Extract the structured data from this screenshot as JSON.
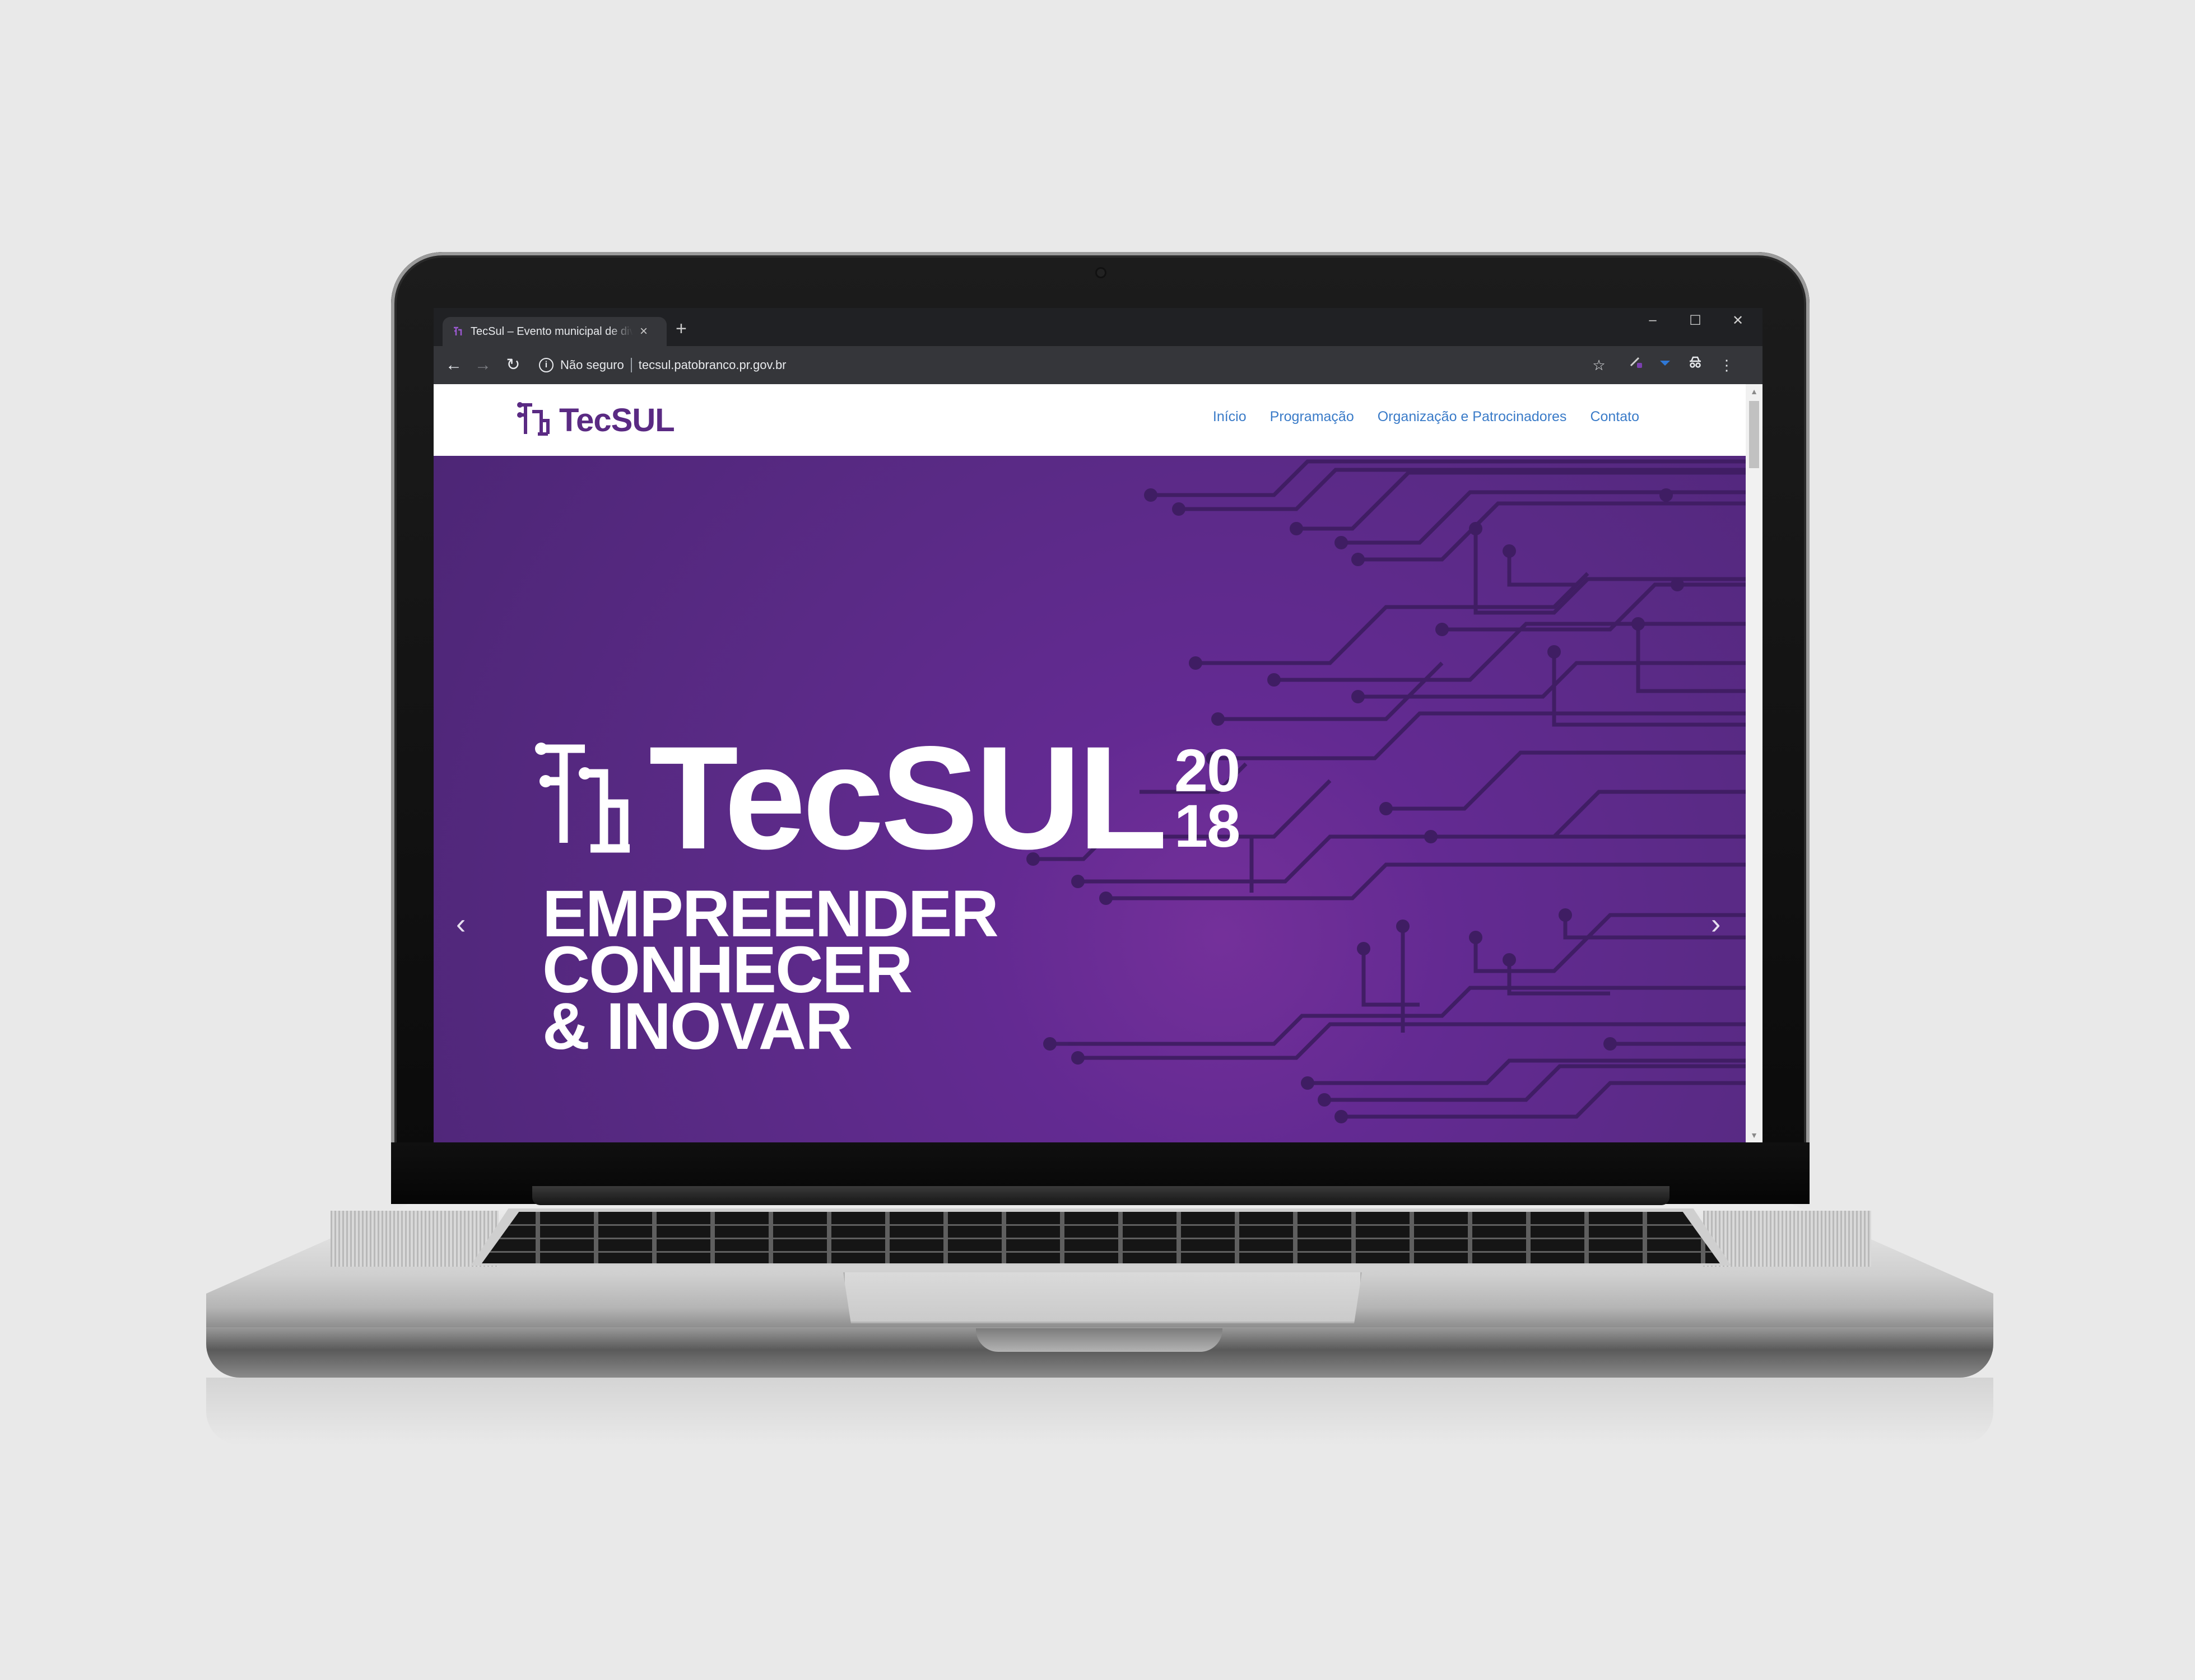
{
  "browser": {
    "tab_title": "TecSul – Evento municipal de divulgação",
    "tab_close": "×",
    "new_tab": "+",
    "window_controls": {
      "minimize": "–",
      "maximize": "☐",
      "close": "✕"
    },
    "nav": {
      "back": "←",
      "forward": "→",
      "reload": "↻"
    },
    "security_label": "Não seguro",
    "url": "tecsul.patobranco.pr.gov.br",
    "icons": [
      "info-icon",
      "star-icon",
      "extension-icon",
      "incognito-icon",
      "menu-icon"
    ]
  },
  "site": {
    "logo_text": "TecSUL",
    "nav_items": [
      {
        "label": "Início"
      },
      {
        "label": "Programação"
      },
      {
        "label": "Organização e Patrocinadores"
      },
      {
        "label": "Contato"
      }
    ],
    "colors": {
      "brand_purple": "#5a2a83",
      "nav_blue": "#3a7bc8",
      "hero_bg": "#5e2a8c"
    }
  },
  "hero": {
    "brand": "TecSUL",
    "year_top": "20",
    "year_bottom": "18",
    "tagline": [
      "EMPREENDER",
      "CONHECER",
      "& INOVAR"
    ],
    "prev_arrow": "‹",
    "next_arrow": "›"
  }
}
